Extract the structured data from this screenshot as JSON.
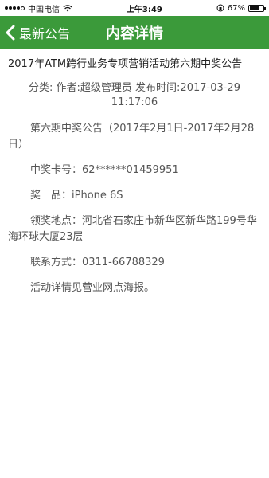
{
  "status_bar": {
    "carrier": "中国电信",
    "time": "上午3:49",
    "battery": "67%",
    "battery_level": 0.67
  },
  "nav": {
    "back_label": "最新公告",
    "title": "内容详情"
  },
  "article": {
    "title": "2017年ATM跨行业务专项营销活动第六期中奖公告",
    "meta_line1": "分类: 作者:超级管理员 发布时间:2017-03-29",
    "meta_line2": "11:17:06",
    "paragraphs": {
      "p1": "第六期中奖公告（2017年2月1日-2017年2月28日）",
      "p2": "中奖卡号：62******01459951",
      "p3": "奖　品：iPhone 6S",
      "p4": "领奖地点：河北省石家庄市新华区新华路199号华海环球大厦23层",
      "p5": "联系方式：0311-66788329",
      "p6": "活动详情见营业网点海报。"
    }
  }
}
